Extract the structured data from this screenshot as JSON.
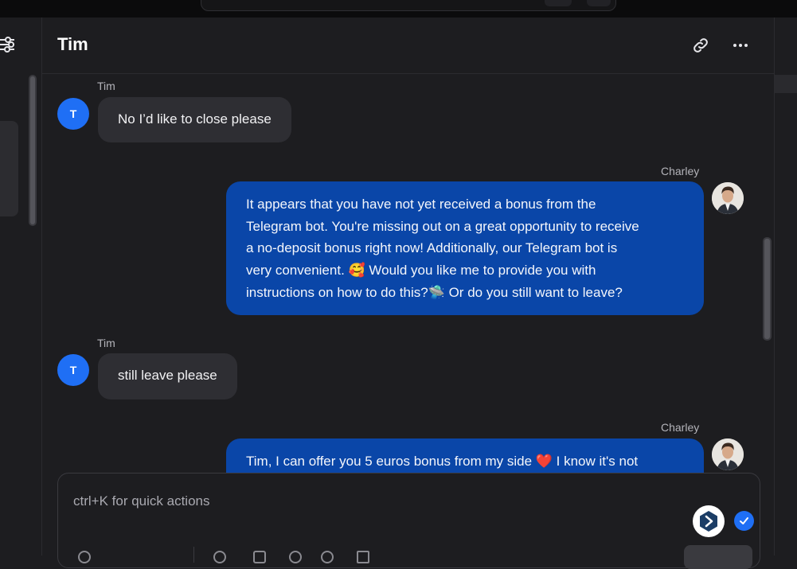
{
  "header": {
    "title": "Tim"
  },
  "messages": [
    {
      "direction": "in",
      "sender": "Tim",
      "avatar_letter": "T",
      "text": "No I’d like to close please"
    },
    {
      "direction": "out",
      "sender": "Charley",
      "lines": [
        "It appears that you have not yet received a bonus from the",
        "Telegram bot. You're missing out on a great opportunity to receive",
        "a no-deposit bonus right now! Additionally, our Telegram bot is",
        "very convenient. "
      ],
      "line4_emoji": "🥰",
      "line4_rest": " Would you like me to provide you with",
      "line5_start": "instructions on how to do this?",
      "line5_emoji": "🛸",
      "line5_rest": " Or do you still want to leave?"
    },
    {
      "direction": "in",
      "sender": "Tim",
      "avatar_letter": "T",
      "text": "still leave please"
    },
    {
      "direction": "out",
      "sender": "Charley",
      "text_start": "Tim, I can offer you 5 euros bonus from my side ",
      "emoji": "❤️",
      "text_rest": " I know it's not"
    }
  ],
  "composer": {
    "placeholder": "ctrl+K for quick actions"
  },
  "colors": {
    "accent": "#1f6ff5",
    "outgoing_bubble": "#0a46a8",
    "incoming_bubble": "#2e2e33"
  },
  "icons": [
    "filter-icon",
    "link-icon",
    "more-icon",
    "bot-icon",
    "check-icon"
  ]
}
